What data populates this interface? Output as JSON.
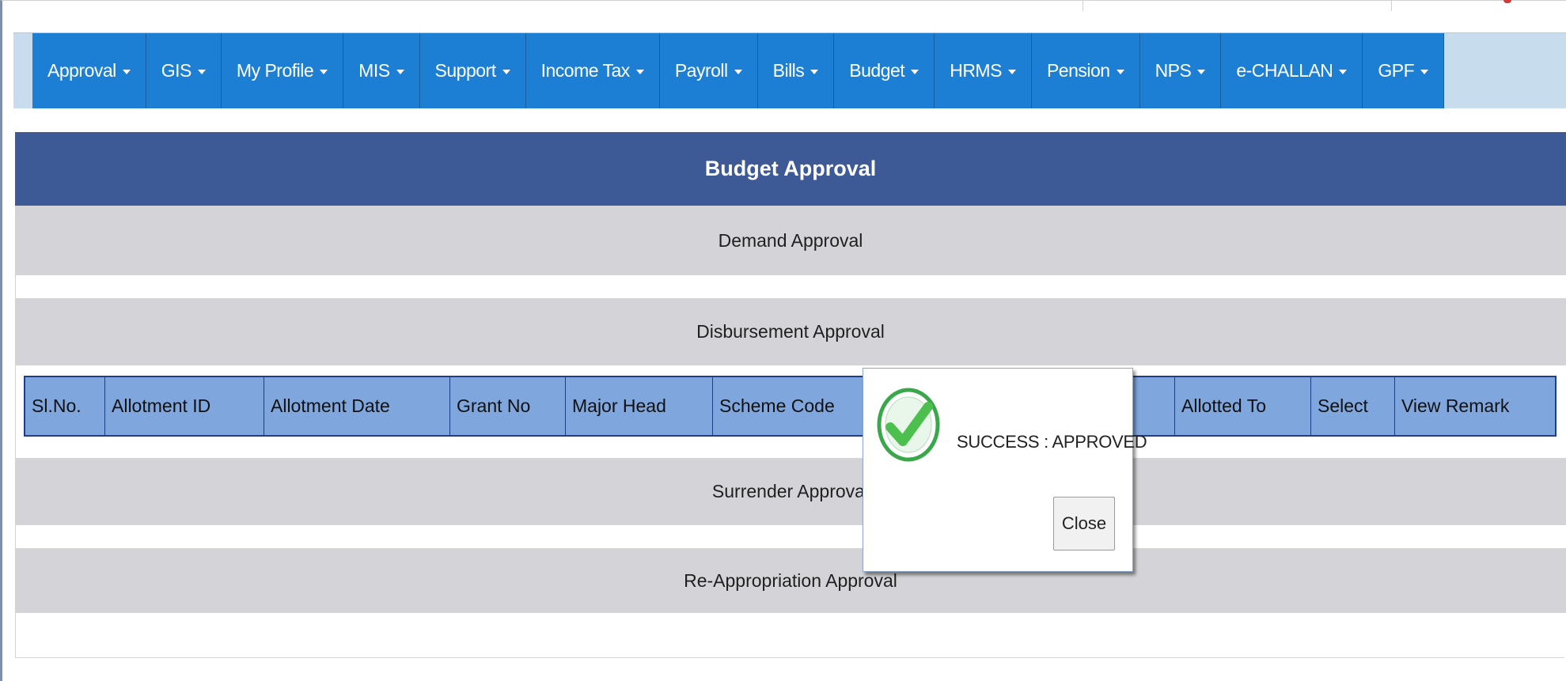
{
  "nav": {
    "items": [
      {
        "label": "Approval"
      },
      {
        "label": "GIS"
      },
      {
        "label": "My Profile"
      },
      {
        "label": "MIS"
      },
      {
        "label": "Support"
      },
      {
        "label": "Income Tax"
      },
      {
        "label": "Payroll"
      },
      {
        "label": "Bills"
      },
      {
        "label": "Budget"
      },
      {
        "label": "HRMS"
      },
      {
        "label": "Pension"
      },
      {
        "label": "NPS"
      },
      {
        "label": "e-CHALLAN"
      },
      {
        "label": "GPF"
      }
    ]
  },
  "panel": {
    "title": "Budget Approval",
    "sections": {
      "demand": "Demand Approval",
      "disbursement": "Disbursement Approval",
      "surrender": "Surrender Approval",
      "reappropriation": "Re-Appropriation Approval"
    }
  },
  "table": {
    "columns": [
      "Sl.No.",
      "Allotment ID",
      "Allotment Date",
      "Grant No",
      "Major Head",
      "Scheme Code",
      "",
      "Allotted To",
      "Select",
      "View Remark"
    ]
  },
  "modal": {
    "message": "SUCCESS : APPROVED",
    "close_label": "Close",
    "icon": "check-circle-icon"
  },
  "colors": {
    "nav_bg": "#1c7fd4",
    "nav_bar_bg": "#c7dcec",
    "panel_header": "#3d5a96",
    "section_bg": "#d4d4d8",
    "table_header_bg": "#7fa6dd",
    "table_border": "#1d3f85",
    "success_green": "#3aa84a"
  }
}
